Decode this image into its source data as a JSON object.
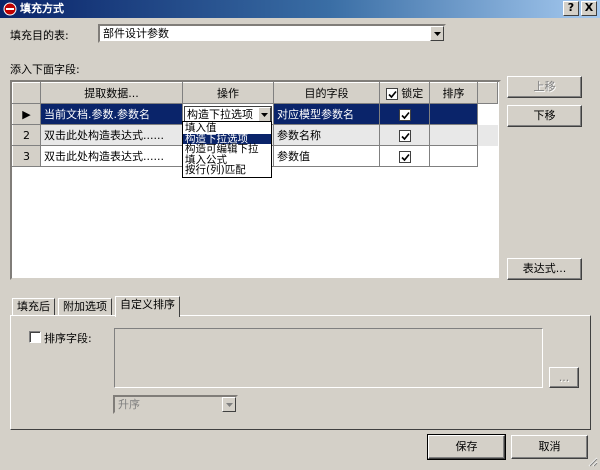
{
  "window": {
    "title": "填充方式",
    "help_button": "?",
    "close_button": "X"
  },
  "fill_target": {
    "label": "填充目的表:",
    "value": "部件设计参数"
  },
  "add_fields_label": "添入下面字段:",
  "grid": {
    "headers": {
      "extract": "提取数据...",
      "operation": "操作",
      "target_field": "目的字段",
      "lock": "锁定",
      "sort": "排序"
    },
    "rows": [
      {
        "num": "▶",
        "source": "当前文档.参数.参数名",
        "operation": "构造下拉选项",
        "target": "对应模型参数名",
        "locked": true,
        "selected": true
      },
      {
        "num": "2",
        "source": "双击此处构造表达式......",
        "operation": "",
        "target": "参数名称",
        "locked": true,
        "selected": false
      },
      {
        "num": "3",
        "source": "双击此处构造表达式......",
        "operation": "",
        "target": "参数值",
        "locked": true,
        "selected": false
      }
    ]
  },
  "operation_dropdown": {
    "options": [
      "填入值",
      "构造下拉选项",
      "构造可编辑下拉",
      "填入公式",
      "按行(列)匹配"
    ],
    "selected_index": 1
  },
  "buttons": {
    "move_up": "上移",
    "move_down": "下移",
    "expression": "表达式...",
    "browse": "...",
    "save": "保存",
    "cancel": "取消"
  },
  "tabs": [
    "填充后",
    "附加选项",
    "自定义排序"
  ],
  "active_tab": 2,
  "sort_panel": {
    "sort_field_label": "排序字段:",
    "sort_field_checked": false,
    "order_value": "升序"
  },
  "colors": {
    "selection": "#0a246a",
    "dialog_bg": "#d4d0c8",
    "title_gradient_start": "#0a246a",
    "title_gradient_end": "#a6caf0"
  }
}
